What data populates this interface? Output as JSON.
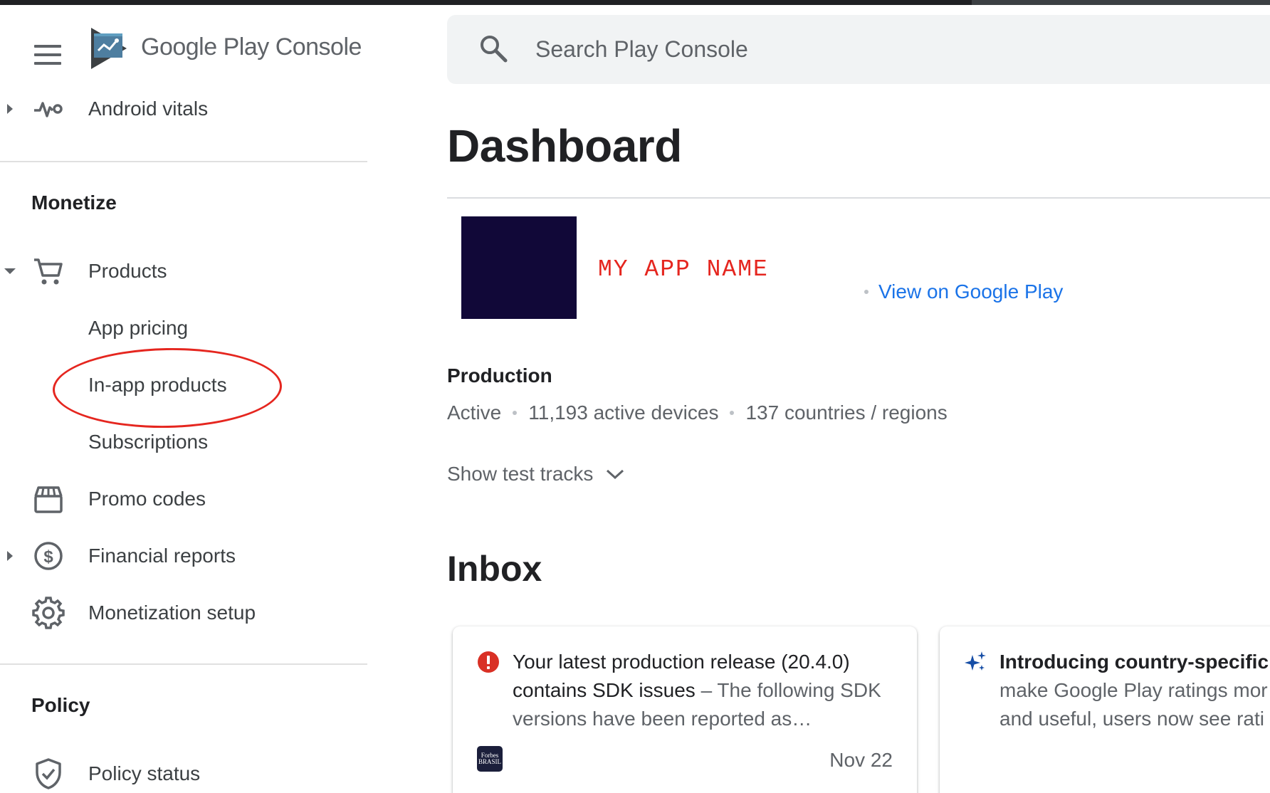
{
  "header": {
    "brand_google_play": "Google Play",
    "brand_console": "Console",
    "search_placeholder": "Search Play Console"
  },
  "sidebar": {
    "top_item": {
      "label": "Android vitals",
      "icon": "vitals-icon"
    },
    "monetize": {
      "title": "Monetize",
      "items": [
        {
          "label": "Products",
          "icon": "cart-icon",
          "expanded": true
        },
        {
          "label": "App pricing"
        },
        {
          "label": "In-app products",
          "highlighted": true
        },
        {
          "label": "Subscriptions"
        },
        {
          "label": "Promo codes",
          "icon": "promo-icon"
        },
        {
          "label": "Financial reports",
          "icon": "dollar-icon"
        },
        {
          "label": "Monetization setup",
          "icon": "gear-icon"
        }
      ]
    },
    "policy": {
      "title": "Policy",
      "items": [
        {
          "label": "Policy status",
          "icon": "shield-icon"
        }
      ]
    }
  },
  "main": {
    "title": "Dashboard",
    "app": {
      "name": "MY APP NAME",
      "icon_color": "#110838",
      "view_link": "View on Google Play"
    },
    "production": {
      "title": "Production",
      "status": "Active",
      "devices": "11,193 active devices",
      "regions": "137 countries / regions"
    },
    "show_test_tracks": "Show test tracks",
    "inbox": {
      "title": "Inbox",
      "cards": [
        {
          "icon": "error-icon",
          "headline": "Your latest production release (20.4.0) contains SDK issues",
          "body": "– The following SDK versions have been reported as…",
          "source_badge": "Forbes BRASIL",
          "date": "Nov 22"
        },
        {
          "icon": "sparkle-icon",
          "headline": "Introducing country-specific r",
          "line2": "make Google Play ratings mor",
          "line3": "and useful, users now see rati"
        }
      ]
    }
  },
  "colors": {
    "accent_link": "#1a73e8",
    "highlight_red": "#e5261f",
    "error_red": "#d93025",
    "sparkle_blue": "#174ea6"
  }
}
